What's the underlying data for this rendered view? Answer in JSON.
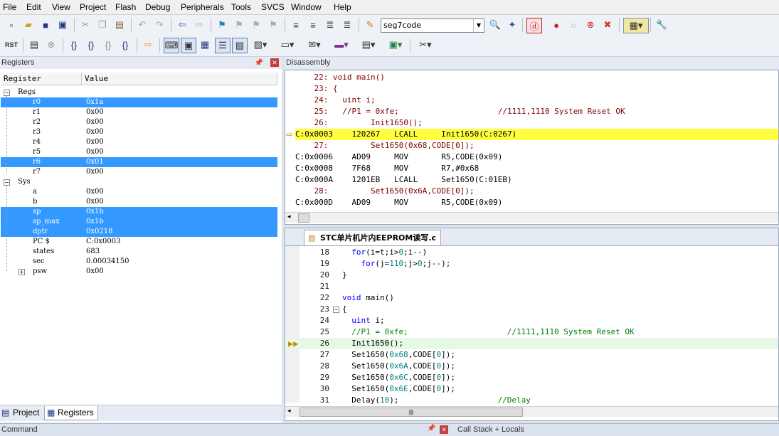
{
  "menu": [
    "File",
    "Edit",
    "View",
    "Project",
    "Flash",
    "Debug",
    "Peripherals",
    "Tools",
    "SVCS",
    "Window",
    "Help"
  ],
  "toolbar": {
    "target_combo": "seg7code"
  },
  "registers_panel": {
    "title": "Registers",
    "col_register": "Register",
    "col_value": "Value",
    "groups": [
      {
        "name": "Regs",
        "rows": [
          {
            "name": "r0",
            "value": "0x1a",
            "selected": true
          },
          {
            "name": "r1",
            "value": "0x00",
            "selected": false
          },
          {
            "name": "r2",
            "value": "0x00",
            "selected": false
          },
          {
            "name": "r3",
            "value": "0x00",
            "selected": false
          },
          {
            "name": "r4",
            "value": "0x00",
            "selected": false
          },
          {
            "name": "r5",
            "value": "0x00",
            "selected": false
          },
          {
            "name": "r6",
            "value": "0x01",
            "selected": true
          },
          {
            "name": "r7",
            "value": "0x00",
            "selected": false
          }
        ]
      },
      {
        "name": "Sys",
        "rows": [
          {
            "name": "a",
            "value": "0x00",
            "selected": false
          },
          {
            "name": "b",
            "value": "0x00",
            "selected": false
          },
          {
            "name": "sp",
            "value": "0x1b",
            "selected": true
          },
          {
            "name": "sp_max",
            "value": "0x1b",
            "selected": true
          },
          {
            "name": "dptr",
            "value": "0x0218",
            "selected": true
          },
          {
            "name": "PC  $",
            "value": "C:0x0003",
            "selected": false
          },
          {
            "name": "states",
            "value": "683",
            "selected": false
          },
          {
            "name": "sec",
            "value": "0.00034150",
            "selected": false
          },
          {
            "name": "psw",
            "value": "0x00",
            "selected": false
          }
        ]
      }
    ]
  },
  "left_tabs": [
    "Project",
    "Registers"
  ],
  "disassembly": {
    "title": "Disassembly",
    "lines": [
      {
        "text": "    22: void main()",
        "type": "src"
      },
      {
        "text": "    23: {",
        "type": "src"
      },
      {
        "text": "    24:   uint i;",
        "type": "src"
      },
      {
        "text": "    25:   //P1 = 0xfe;                     //1111,1110 System Reset OK",
        "type": "src"
      },
      {
        "text": "    26:         Init1650();",
        "type": "src"
      },
      {
        "text": "C:0x0003    120267   LCALL     Init1650(C:0267)",
        "type": "cur"
      },
      {
        "text": "    27:         Set1650(0x68,CODE[0]);",
        "type": "src"
      },
      {
        "text": "C:0x0006    AD09     MOV       R5,CODE(0x09)",
        "type": "asm"
      },
      {
        "text": "C:0x0008    7F68     MOV       R7,#0x68",
        "type": "asm"
      },
      {
        "text": "C:0x000A    1201EB   LCALL     Set1650(C:01EB)",
        "type": "asm"
      },
      {
        "text": "    28:         Set1650(0x6A,CODE[0]);",
        "type": "src"
      },
      {
        "text": "C:0x000D    AD09     MOV       R5,CODE(0x09)",
        "type": "asm"
      }
    ]
  },
  "editor": {
    "tab_title": "STC单片机片内EEPROM读写.c",
    "lines": [
      {
        "n": "18",
        "code": "  for(i=t;i>0;i--)"
      },
      {
        "n": "19",
        "code": "    for(j=110;j>0;j--);"
      },
      {
        "n": "20",
        "code": "}"
      },
      {
        "n": "21",
        "code": ""
      },
      {
        "n": "22",
        "code": "void main()"
      },
      {
        "n": "23",
        "code": "{"
      },
      {
        "n": "24",
        "code": "  uint i;"
      },
      {
        "n": "25",
        "code": "  //P1 = 0xfe;                     //1111,1110 System Reset OK"
      },
      {
        "n": "26",
        "code": "  Init1650();"
      },
      {
        "n": "27",
        "code": "  Set1650(0x68,CODE[0]);"
      },
      {
        "n": "28",
        "code": "  Set1650(0x6A,CODE[0]);"
      },
      {
        "n": "29",
        "code": "  Set1650(0x6C,CODE[0]);"
      },
      {
        "n": "30",
        "code": "  Set1650(0x6E,CODE[0]);"
      },
      {
        "n": "31",
        "code": "  Delay(10);                     //Delay"
      }
    ]
  },
  "bottom": {
    "command": "Command",
    "callstack": "Call Stack + Locals"
  }
}
